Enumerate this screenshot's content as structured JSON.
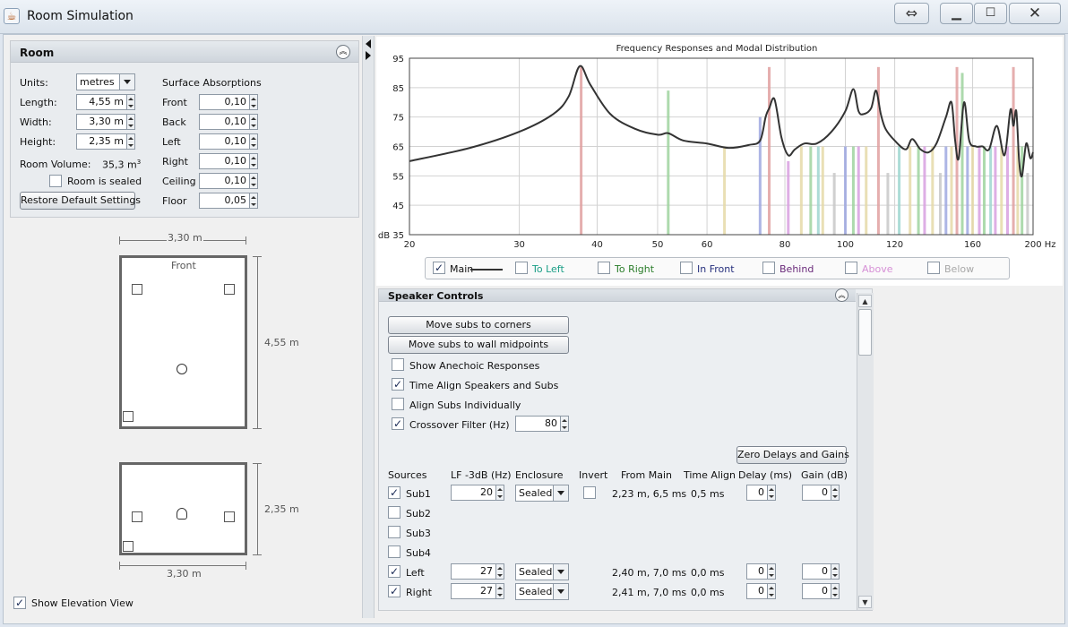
{
  "window": {
    "title": "Room Simulation"
  },
  "room": {
    "title": "Room",
    "units_label": "Units:",
    "units_value": "metres",
    "length_label": "Length:",
    "length_value": "4,55 m",
    "width_label": "Width:",
    "width_value": "3,30 m",
    "height_label": "Height:",
    "height_value": "2,35 m",
    "volume_label": "Room Volume:",
    "volume_value": "35,3 m",
    "volume_unit_sup": "3",
    "sealed_label": "Room is sealed",
    "sealed_checked": false,
    "restore_label": "Restore Default Settings",
    "absorptions_title": "Surface Absorptions",
    "surfaces": [
      {
        "label": "Front",
        "value": "0,10"
      },
      {
        "label": "Back",
        "value": "0,10"
      },
      {
        "label": "Left",
        "value": "0,10"
      },
      {
        "label": "Right",
        "value": "0,10"
      },
      {
        "label": "Ceiling",
        "value": "0,10"
      },
      {
        "label": "Floor",
        "value": "0,05"
      }
    ]
  },
  "plan": {
    "top_dim": "3,30 m",
    "front_label": "Front",
    "side_dim": "4,55 m"
  },
  "elevation": {
    "side_dim": "2,35 m",
    "bottom_dim": "3,30 m"
  },
  "show_elevation": {
    "label": "Show Elevation View",
    "checked": true
  },
  "chart_data": {
    "type": "line",
    "title": "Frequency Responses and Modal Distribution",
    "xlabel": "Hz",
    "ylabel": "dB",
    "xscale": "log",
    "xlim": [
      20,
      200
    ],
    "ylim": [
      35,
      95
    ],
    "xticks": [
      20,
      30,
      40,
      50,
      60,
      80,
      100,
      120,
      160,
      200
    ],
    "xtick_labels": [
      "20",
      "30",
      "40",
      "50",
      "60",
      "80",
      "100",
      "120",
      "160",
      "200 Hz"
    ],
    "yticks": [
      35,
      45,
      55,
      65,
      75,
      85,
      95
    ],
    "ytick_labels": [
      "dB 35",
      "45",
      "55",
      "65",
      "75",
      "85",
      "95"
    ],
    "grid": true,
    "series": [
      {
        "name": "Main",
        "color": "#333333",
        "x": [
          20,
          25,
          30,
          34,
          36,
          37.5,
          39,
          42,
          46,
          50,
          52,
          55,
          60,
          65,
          70,
          73,
          74.5,
          75.5,
          77,
          79,
          81,
          83,
          86,
          90,
          95,
          100,
          103,
          105,
          107,
          110,
          112,
          114,
          116,
          120,
          125,
          128,
          132,
          136,
          140,
          145,
          148,
          150,
          152,
          155,
          158,
          162,
          166,
          170,
          175,
          180,
          184,
          186,
          188,
          190,
          192,
          195,
          198,
          200
        ],
        "y": [
          60,
          64.5,
          70,
          76,
          82,
          92.3,
          86,
          76,
          71,
          69,
          69.5,
          67,
          66,
          64.5,
          65.5,
          67,
          75,
          78,
          81,
          68,
          62,
          64,
          66,
          66,
          70,
          77,
          84.5,
          77,
          76,
          78,
          84,
          76,
          71,
          67,
          64,
          67.5,
          64,
          63,
          66,
          75,
          80,
          67,
          61,
          80,
          67,
          65,
          65,
          64,
          72,
          62,
          77.5,
          72,
          77,
          60,
          55,
          66,
          61,
          63
        ]
      },
      {
        "name": "To Left",
        "color": "#1a9e86"
      },
      {
        "name": "To Right",
        "color": "#2a7d2a"
      },
      {
        "name": "In Front",
        "color": "#26307d"
      },
      {
        "name": "Behind",
        "color": "#6a2a7a"
      },
      {
        "name": "Above",
        "color": "#d68fd6"
      },
      {
        "name": "Below",
        "color": "#a8a8a8"
      }
    ],
    "modes": [
      {
        "f": 37.7,
        "top": 92,
        "color": "#e0a0a0"
      },
      {
        "f": 52,
        "top": 84,
        "color": "#9fd49f"
      },
      {
        "f": 64,
        "top": 65,
        "color": "#e5d9a8"
      },
      {
        "f": 73,
        "top": 75,
        "color": "#9fa8e0"
      },
      {
        "f": 75.5,
        "top": 92,
        "color": "#e0a0a0"
      },
      {
        "f": 81,
        "top": 60,
        "color": "#d8a0e0"
      },
      {
        "f": 85,
        "top": 65,
        "color": "#e5d9a8"
      },
      {
        "f": 88,
        "top": 65,
        "color": "#9fd49f"
      },
      {
        "f": 90.5,
        "top": 65,
        "color": "#9fd6d0"
      },
      {
        "f": 92,
        "top": 65,
        "color": "#e5d9a8"
      },
      {
        "f": 96,
        "top": 56,
        "color": "#c8c8c8"
      },
      {
        "f": 100,
        "top": 65,
        "color": "#9fa8e0"
      },
      {
        "f": 103,
        "top": 65,
        "color": "#9fd49f"
      },
      {
        "f": 105,
        "top": 65,
        "color": "#d8a0e0"
      },
      {
        "f": 108,
        "top": 65,
        "color": "#e5d9a8"
      },
      {
        "f": 113,
        "top": 92,
        "color": "#e0a0a0"
      },
      {
        "f": 117,
        "top": 56,
        "color": "#c8c8c8"
      },
      {
        "f": 122,
        "top": 65,
        "color": "#9fd6d0"
      },
      {
        "f": 127,
        "top": 65,
        "color": "#e5d9a8"
      },
      {
        "f": 131,
        "top": 65,
        "color": "#9fd49f"
      },
      {
        "f": 134,
        "top": 65,
        "color": "#d8a0e0"
      },
      {
        "f": 138,
        "top": 65,
        "color": "#e5d9a8"
      },
      {
        "f": 142,
        "top": 56,
        "color": "#c8c8c8"
      },
      {
        "f": 145,
        "top": 65,
        "color": "#9fa8e0"
      },
      {
        "f": 148,
        "top": 65,
        "color": "#e5d9a8"
      },
      {
        "f": 151,
        "top": 92,
        "color": "#e0a0a0"
      },
      {
        "f": 154,
        "top": 90,
        "color": "#9fd49f"
      },
      {
        "f": 157,
        "top": 65,
        "color": "#9fa8e0"
      },
      {
        "f": 160,
        "top": 65,
        "color": "#e5d9a8"
      },
      {
        "f": 164,
        "top": 65,
        "color": "#d8a0e0"
      },
      {
        "f": 167,
        "top": 65,
        "color": "#9fd49f"
      },
      {
        "f": 171,
        "top": 65,
        "color": "#9fd6d0"
      },
      {
        "f": 174,
        "top": 65,
        "color": "#d8a0e0"
      },
      {
        "f": 178,
        "top": 65,
        "color": "#e5d9a8"
      },
      {
        "f": 182,
        "top": 65,
        "color": "#d8a0e0"
      },
      {
        "f": 186,
        "top": 92,
        "color": "#e0a0a0"
      },
      {
        "f": 189,
        "top": 65,
        "color": "#e5d9a8"
      },
      {
        "f": 192,
        "top": 65,
        "color": "#9fd49f"
      },
      {
        "f": 196,
        "top": 56,
        "color": "#c8c8c8"
      }
    ]
  },
  "legend": [
    {
      "label": "Main",
      "checked": true,
      "color": "#333333"
    },
    {
      "label": "To Left",
      "checked": false,
      "color": "#1a9e86"
    },
    {
      "label": "To Right",
      "checked": false,
      "color": "#2a7d2a"
    },
    {
      "label": "In Front",
      "checked": false,
      "color": "#26307d"
    },
    {
      "label": "Behind",
      "checked": false,
      "color": "#6a2a7a"
    },
    {
      "label": "Above",
      "checked": false,
      "color": "#d68fd6"
    },
    {
      "label": "Below",
      "checked": false,
      "color": "#a8a8a8"
    }
  ],
  "speaker": {
    "title": "Speaker Controls",
    "move_corners": "Move subs to corners",
    "move_midpoints": "Move subs to wall midpoints",
    "show_anechoic": {
      "label": "Show Anechoic Responses",
      "checked": false
    },
    "time_align": {
      "label": "Time Align Speakers and Subs",
      "checked": true
    },
    "align_subs": {
      "label": "Align Subs Individually",
      "checked": false
    },
    "crossover": {
      "label": "Crossover Filter (Hz)",
      "checked": true,
      "value": "80"
    },
    "zero_label": "Zero Delays and Gains",
    "headers": {
      "sources": "Sources",
      "lf": "LF -3dB (Hz)",
      "enclosure": "Enclosure",
      "invert": "Invert",
      "from_main": "From Main",
      "time_align": "Time Align",
      "delay": "Delay (ms)",
      "gain": "Gain (dB)"
    },
    "rows": [
      {
        "name": "Sub1",
        "checked": true,
        "lf": "20",
        "enclosure": "Sealed",
        "invert": false,
        "from_main": "2,23 m, 6,5 ms",
        "time_align": "0,5 ms",
        "delay": "0",
        "gain": "0"
      },
      {
        "name": "Sub2",
        "checked": false
      },
      {
        "name": "Sub3",
        "checked": false
      },
      {
        "name": "Sub4",
        "checked": false
      },
      {
        "name": "Left",
        "checked": true,
        "lf": "27",
        "enclosure": "Sealed",
        "from_main": "2,40 m, 7,0 ms",
        "time_align": "0,0 ms",
        "delay": "0",
        "gain": "0"
      },
      {
        "name": "Right",
        "checked": true,
        "lf": "27",
        "enclosure": "Sealed",
        "from_main": "2,41 m, 7,0 ms",
        "time_align": "0,0 ms",
        "delay": "0",
        "gain": "0"
      }
    ]
  }
}
